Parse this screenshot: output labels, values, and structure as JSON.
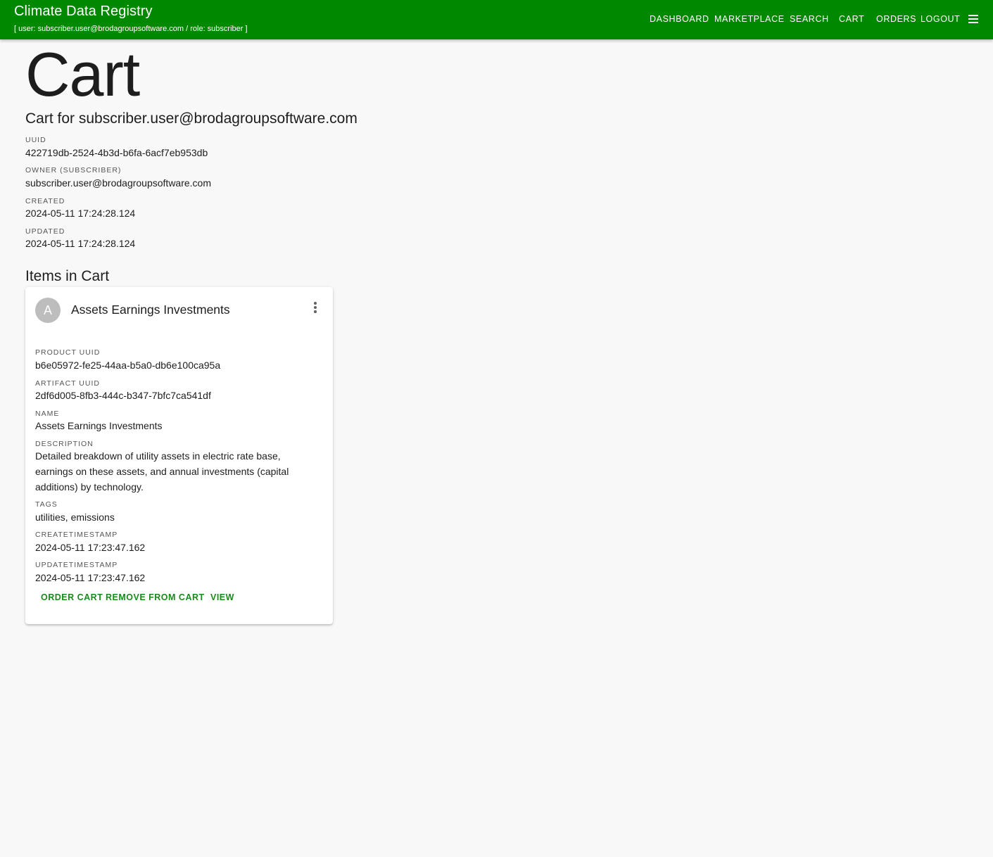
{
  "header": {
    "title": "Climate Data Registry",
    "subtitle": "[ user: subscriber.user@brodagroupsoftware.com / role: subscriber ]",
    "nav": {
      "dashboard": "DASHBOARD",
      "marketplace": "MARKETPLACE",
      "search": "SEARCH",
      "cart": "CART",
      "orders": "ORDERS",
      "logout": "LOGOUT"
    },
    "menu_icon": "menu-icon"
  },
  "page": {
    "heading": "Cart",
    "cart_for": "Cart for subscriber.user@brodagroupsoftware.com"
  },
  "cart": {
    "uuid_label": "UUID",
    "uuid": "422719db-2524-4b3d-b6fa-6acf7eb953db",
    "owner_label": "OWNER (SUBSCRIBER)",
    "owner": "subscriber.user@brodagroupsoftware.com",
    "created_label": "CREATED",
    "created": "2024-05-11 17:24:28.124",
    "updated_label": "UPDATED",
    "updated": "2024-05-11 17:24:28.124"
  },
  "items_heading": "Items in Cart",
  "item": {
    "avatar_letter": "A",
    "title": "Assets Earnings Investments",
    "product_uuid_label": "PRODUCT UUID",
    "product_uuid": "b6e05972-fe25-44aa-b5a0-db6e100ca95a",
    "artifact_uuid_label": "ARTIFACT UUID",
    "artifact_uuid": "2df6d005-8fb3-444c-b347-7bfc7ca541df",
    "name_label": "NAME",
    "name": "Assets Earnings Investments",
    "description_label": "DESCRIPTION",
    "description": "Detailed breakdown of utility assets in electric rate base, earnings on these assets, and annual investments (capital additions) by technology.",
    "tags_label": "TAGS",
    "tags": "utilities, emissions",
    "create_label": "CREATETIMESTAMP",
    "create": "2024-05-11 17:23:47.162",
    "update_label": "UPDATETIMESTAMP",
    "update": "2024-05-11 17:23:47.162",
    "actions": {
      "order": "ORDER CART",
      "remove": "REMOVE FROM CART",
      "view": "VIEW"
    },
    "more_icon": "more-vert-icon"
  },
  "colors": {
    "appbar": "#008900",
    "action": "#1b8a1b",
    "background": "#f8f8f8",
    "avatar": "#bdbdbd"
  }
}
